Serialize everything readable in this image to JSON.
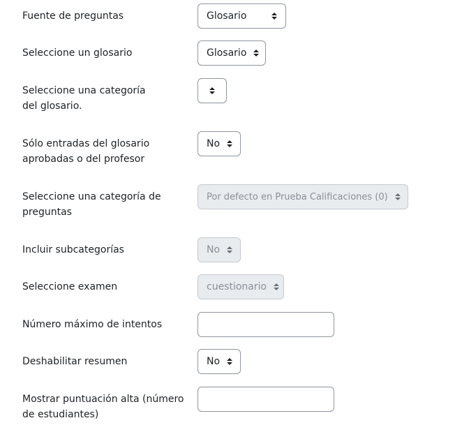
{
  "fields": [
    {
      "label": "Fuente de preguntas",
      "type": "select",
      "value": "Glosario",
      "disabled": false
    },
    {
      "label": "Seleccione un glosario",
      "type": "select",
      "value": "Glosario",
      "disabled": false
    },
    {
      "label": "Seleccione una categoría del glosario.",
      "type": "select",
      "value": "",
      "disabled": false
    },
    {
      "label": "Sólo entradas del glosario aprobadas o del profesor",
      "type": "select",
      "value": "No",
      "disabled": false
    },
    {
      "label": "Seleccione una categoría de preguntas",
      "type": "select",
      "value": "Por defecto en Prueba Calificaciones (0)",
      "disabled": true
    },
    {
      "label": "Incluir subcategorías",
      "type": "select",
      "value": "No",
      "disabled": true
    },
    {
      "label": "Seleccione examen",
      "type": "select",
      "value": "cuestionario",
      "disabled": true
    },
    {
      "label": "Número máximo de intentos",
      "type": "text",
      "value": "",
      "disabled": false
    },
    {
      "label": "Deshabilitar resumen",
      "type": "select",
      "value": "No",
      "disabled": false
    },
    {
      "label": "Mostrar puntuación alta (número de estudiantes)",
      "type": "text",
      "value": "",
      "disabled": false
    }
  ],
  "colors": {
    "text": "#1d2125",
    "border": "#8f959e",
    "disabled_bg": "#e9ecef",
    "disabled_text": "#8a9097"
  }
}
